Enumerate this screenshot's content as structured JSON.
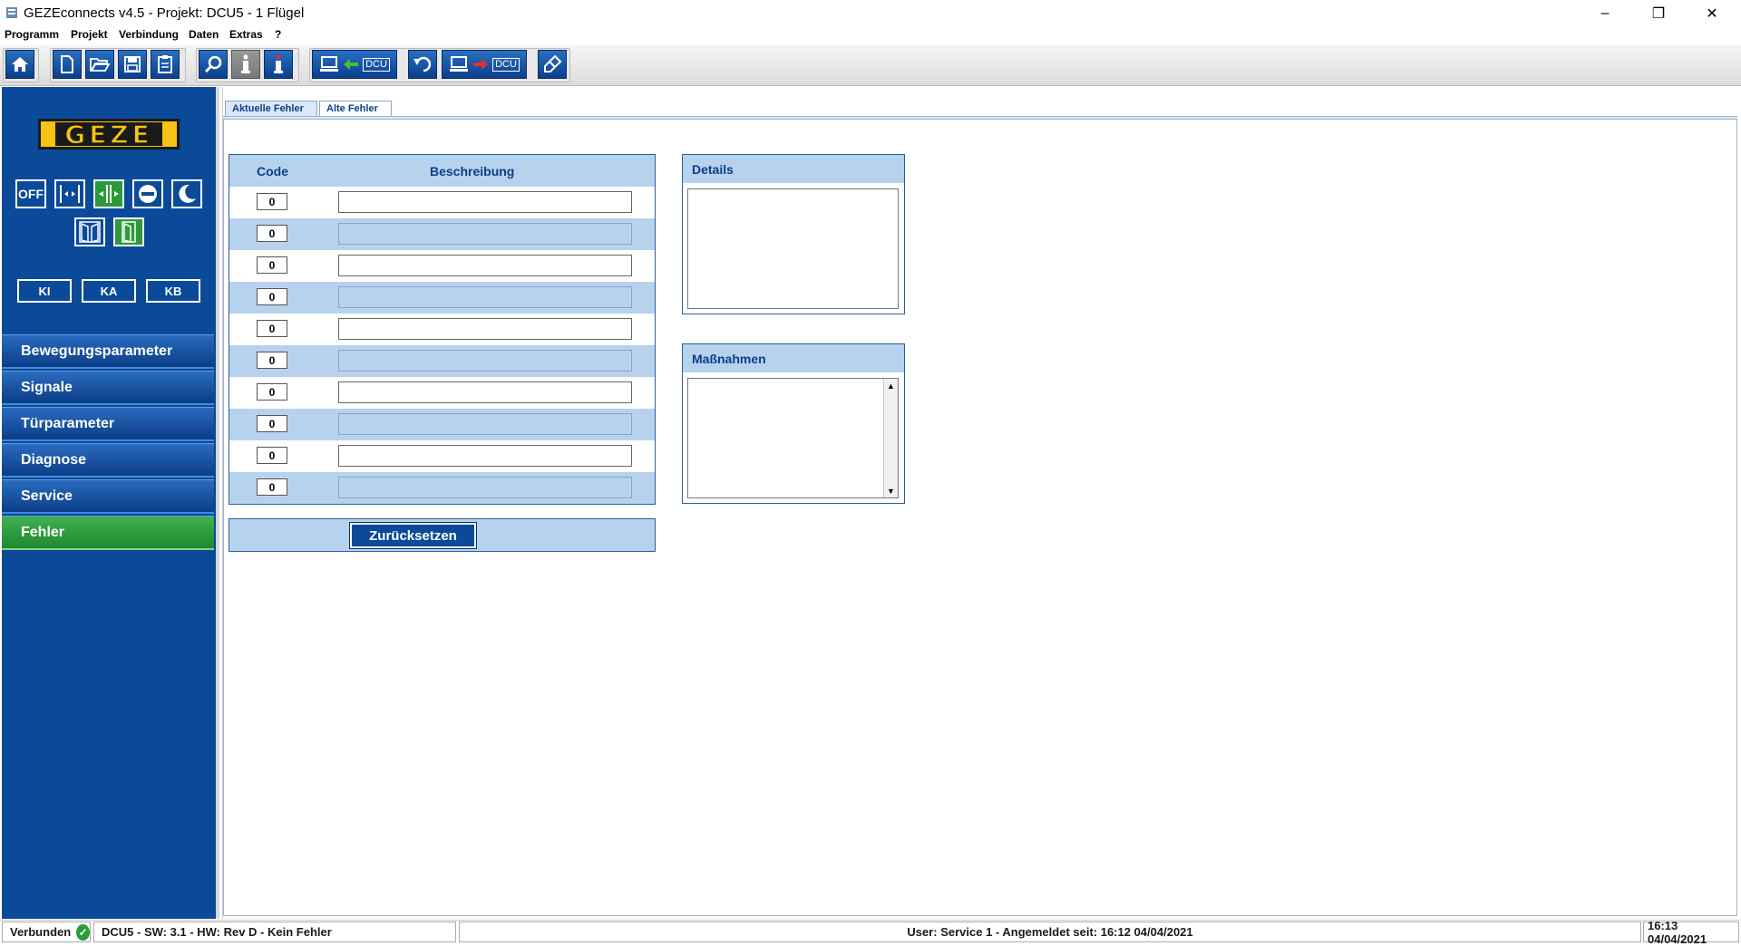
{
  "window": {
    "title": "GEZEconnects v4.5 - Projekt: DCU5 - 1 Flügel",
    "minimize": "–",
    "restore": "❐",
    "close": "✕"
  },
  "menu": [
    "Programm",
    "Projekt",
    "Verbindung",
    "Daten",
    "Extras",
    "?"
  ],
  "toolbar": {
    "dcu_label": "DCU"
  },
  "sidebar": {
    "logo": "GEZE",
    "off_label": "OFF",
    "k_buttons": [
      "KI",
      "KA",
      "KB"
    ],
    "nav": [
      "Bewegungsparameter",
      "Signale",
      "Türparameter",
      "Diagnose",
      "Service",
      "Fehler"
    ]
  },
  "tabs": [
    "Aktuelle Fehler",
    "Alte Fehler"
  ],
  "errors": {
    "col_code": "Code",
    "col_desc": "Beschreibung",
    "rows": [
      {
        "code": "0",
        "desc": ""
      },
      {
        "code": "0",
        "desc": ""
      },
      {
        "code": "0",
        "desc": ""
      },
      {
        "code": "0",
        "desc": ""
      },
      {
        "code": "0",
        "desc": ""
      },
      {
        "code": "0",
        "desc": ""
      },
      {
        "code": "0",
        "desc": ""
      },
      {
        "code": "0",
        "desc": ""
      },
      {
        "code": "0",
        "desc": ""
      },
      {
        "code": "0",
        "desc": ""
      }
    ],
    "reset_label": "Zurücksetzen"
  },
  "details": {
    "title": "Details",
    "text": ""
  },
  "measures": {
    "title": "Maßnahmen",
    "text": ""
  },
  "status": {
    "connected": "Verbunden",
    "device": "DCU5 -  SW: 3.1 -  HW: Rev D - Kein Fehler",
    "user": "User: Service 1 - Angemeldet seit:  16:12  04/04/2021",
    "clock": "16:13  04/04/2021"
  },
  "colors": {
    "brand_blue": "#0a4a99",
    "active_green": "#2a9a3a",
    "logo_yellow": "#f7c316",
    "panel_light_blue": "#b7d2ec"
  }
}
